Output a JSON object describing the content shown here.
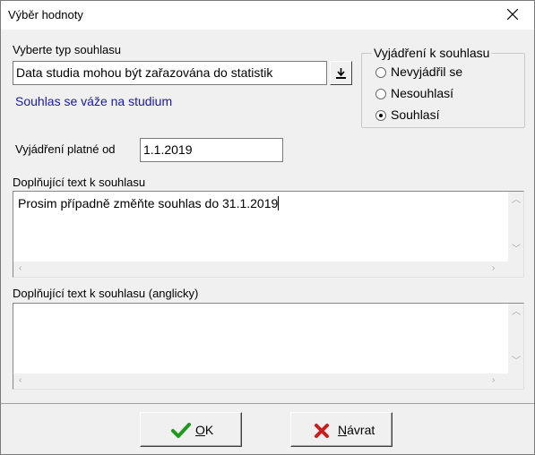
{
  "window": {
    "title": "Výběr hodnoty"
  },
  "consent_type": {
    "label": "Vyberte typ souhlasu",
    "value": "Data studia mohou být zařazována do statistik",
    "note": "Souhlas se váže na studium"
  },
  "statement": {
    "title": "Vyjádření k souhlasu",
    "options": [
      {
        "label": "Nevyjádřil se",
        "selected": false
      },
      {
        "label": "Nesouhlasí",
        "selected": false
      },
      {
        "label": "Souhlasí",
        "selected": true
      }
    ]
  },
  "valid_from": {
    "label": "Vyjádření platné od",
    "value": "1.1.2019"
  },
  "extra_text": {
    "label": "Doplňující text k souhlasu",
    "value": "Prosim případně změňte souhlas do 31.1.2019"
  },
  "extra_text_en": {
    "label": "Doplňující text k souhlasu (anglicky)",
    "value": ""
  },
  "buttons": {
    "ok_mnemonic": "O",
    "ok_rest": "K",
    "back_mnemonic": "N",
    "back_rest": "ávrat"
  },
  "colors": {
    "ok_icon": "#1f9a1f",
    "back_icon": "#c81e1e",
    "note_text": "#1a1a9a"
  },
  "icons": {
    "close": "close-icon",
    "ok": "checkmark-icon",
    "back": "cross-icon",
    "dropdown": "arrow-down-icon"
  }
}
